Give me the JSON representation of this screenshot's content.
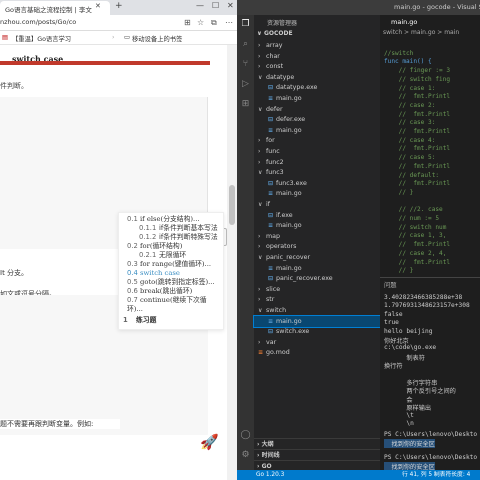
{
  "browser": {
    "tab_title": "Go语言基础之流程控制 | 李文",
    "url": "nzhou.com/posts/Go/co",
    "bookmarks": [
      "【重温】Go语言学习",
      "移动设备上的书签"
    ],
    "heading": "switch case",
    "note": "件判断。",
    "text_lines": [
      "It 分支。",
      "如文或逗号分隔。",
      "题不需要再跟判断变量。例如:"
    ]
  },
  "toc": [
    {
      "num": "0.1",
      "label": "if else(分支结构)...",
      "level": 1,
      "active": false
    },
    {
      "num": "0.1.1",
      "label": "if条件判断基本写法",
      "level": 2,
      "active": false
    },
    {
      "num": "0.1.2",
      "label": "if条件判断特殊写法",
      "level": 2,
      "active": false
    },
    {
      "num": "0.2",
      "label": "for(循环结构)",
      "level": 1,
      "active": false
    },
    {
      "num": "0.2.1",
      "label": "无限循环",
      "level": 2,
      "active": false
    },
    {
      "num": "0.3",
      "label": "for range(键值循环)...",
      "level": 1,
      "active": false
    },
    {
      "num": "0.4",
      "label": "switch case",
      "level": 1,
      "active": true
    },
    {
      "num": "0.5",
      "label": "goto(跳转到指定标签)...",
      "level": 1,
      "active": false
    },
    {
      "num": "0.6",
      "label": "break(跳出循环)",
      "level": 1,
      "active": false
    },
    {
      "num": "0.7",
      "label": "continue(继续下次循环)...",
      "level": 1,
      "active": false
    },
    {
      "num": "1",
      "label": "练习题",
      "level": 0,
      "active": false
    }
  ],
  "vscode": {
    "title": "main.go - gocode - Visual Studio C",
    "explorer_header": "资源管理器",
    "workspace": "GOCODE",
    "tree": [
      {
        "label": "array",
        "kind": "folder",
        "depth": 0,
        "open": false
      },
      {
        "label": "char",
        "kind": "folder",
        "depth": 0,
        "open": false
      },
      {
        "label": "const",
        "kind": "folder",
        "depth": 0,
        "open": false
      },
      {
        "label": "datatype",
        "kind": "folder",
        "depth": 0,
        "open": true
      },
      {
        "label": "datatype.exe",
        "kind": "exe",
        "depth": 1
      },
      {
        "label": "main.go",
        "kind": "go",
        "depth": 1
      },
      {
        "label": "defer",
        "kind": "folder",
        "depth": 0,
        "open": true
      },
      {
        "label": "defer.exe",
        "kind": "exe",
        "depth": 1
      },
      {
        "label": "main.go",
        "kind": "go",
        "depth": 1
      },
      {
        "label": "for",
        "kind": "folder",
        "depth": 0,
        "open": false
      },
      {
        "label": "func",
        "kind": "folder",
        "depth": 0,
        "open": false
      },
      {
        "label": "func2",
        "kind": "folder",
        "depth": 0,
        "open": false
      },
      {
        "label": "func3",
        "kind": "folder",
        "depth": 0,
        "open": true
      },
      {
        "label": "func3.exe",
        "kind": "exe",
        "depth": 1
      },
      {
        "label": "main.go",
        "kind": "go",
        "depth": 1
      },
      {
        "label": "if",
        "kind": "folder",
        "depth": 0,
        "open": true
      },
      {
        "label": "if.exe",
        "kind": "exe",
        "depth": 1
      },
      {
        "label": "main.go",
        "kind": "go",
        "depth": 1
      },
      {
        "label": "map",
        "kind": "folder",
        "depth": 0,
        "open": false
      },
      {
        "label": "operators",
        "kind": "folder",
        "depth": 0,
        "open": false
      },
      {
        "label": "panic_recover",
        "kind": "folder",
        "depth": 0,
        "open": true
      },
      {
        "label": "main.go",
        "kind": "go",
        "depth": 1
      },
      {
        "label": "panic_recover.exe",
        "kind": "exe",
        "depth": 1
      },
      {
        "label": "slice",
        "kind": "folder",
        "depth": 0,
        "open": false
      },
      {
        "label": "str",
        "kind": "folder",
        "depth": 0,
        "open": false
      },
      {
        "label": "switch",
        "kind": "folder",
        "depth": 0,
        "open": true
      },
      {
        "label": "main.go",
        "kind": "go",
        "depth": 1,
        "selected": true
      },
      {
        "label": "switch.exe",
        "kind": "exe",
        "depth": 1
      },
      {
        "label": "var",
        "kind": "folder",
        "depth": 0,
        "open": false
      },
      {
        "label": "go.mod",
        "kind": "mod",
        "depth": 0
      }
    ],
    "bottom_sections": [
      "大纲",
      "时间线",
      "GO"
    ],
    "editor_tab": "main.go",
    "breadcrumb": "switch > main.go > main",
    "code_lines": [
      {
        "text": "",
        "color": "#d4d4d4"
      },
      {
        "text": "//switch",
        "color": "#6a9955"
      },
      {
        "text": "func main() {",
        "color": "#569cd6"
      },
      {
        "text": "    // finger := 3",
        "color": "#6a9955"
      },
      {
        "text": "    // switch fing",
        "color": "#6a9955"
      },
      {
        "text": "    // case 1:",
        "color": "#6a9955"
      },
      {
        "text": "    //  fmt.Printl",
        "color": "#6a9955"
      },
      {
        "text": "    // case 2:",
        "color": "#6a9955"
      },
      {
        "text": "    //  fmt.Printl",
        "color": "#6a9955"
      },
      {
        "text": "    // case 3:",
        "color": "#6a9955"
      },
      {
        "text": "    //  fmt.Printl",
        "color": "#6a9955"
      },
      {
        "text": "    // case 4:",
        "color": "#6a9955"
      },
      {
        "text": "    //  fmt.Printl",
        "color": "#6a9955"
      },
      {
        "text": "    // case 5:",
        "color": "#6a9955"
      },
      {
        "text": "    //  fmt.Printl",
        "color": "#6a9955"
      },
      {
        "text": "    // default:",
        "color": "#6a9955"
      },
      {
        "text": "    //  fmt.Printl",
        "color": "#6a9955"
      },
      {
        "text": "    // }",
        "color": "#6a9955"
      },
      {
        "text": "",
        "color": "#d4d4d4"
      },
      {
        "text": "    // //2. case",
        "color": "#6a9955"
      },
      {
        "text": "    // num := 5",
        "color": "#6a9955"
      },
      {
        "text": "    // switch num",
        "color": "#6a9955"
      },
      {
        "text": "    // case 1, 3,",
        "color": "#6a9955"
      },
      {
        "text": "    //  fmt.Printl",
        "color": "#6a9955"
      },
      {
        "text": "    // case 2, 4,",
        "color": "#6a9955"
      },
      {
        "text": "    //  fmt.Printl",
        "color": "#6a9955"
      },
      {
        "text": "    // }",
        "color": "#6a9955"
      }
    ],
    "panel_tab": "问题",
    "terminal_lines": [
      "3.402823466385288e+38",
      "1.7976931348623157e+308",
      "false",
      "true",
      "hello beijing",
      "你好北京",
      "c:\\code\\go.exe",
      "      制表符",
      "换行符",
      "",
      "      多行字符串",
      "      两个反引号之间的",
      "      会",
      "      原样输出",
      "      \\t",
      "      \\n",
      "",
      "PS C:\\Users\\lenovo\\Deskto"
    ],
    "terminal_highlight_1": "  找到你的安全区",
    "terminal_prompt_2": "PS C:\\Users\\lenovo\\Deskto",
    "terminal_highlight_2": "  找到你的安全区",
    "status_left": "Go 1.20.3",
    "status_right": "行 41, 列 5  制表符长度: 4"
  }
}
